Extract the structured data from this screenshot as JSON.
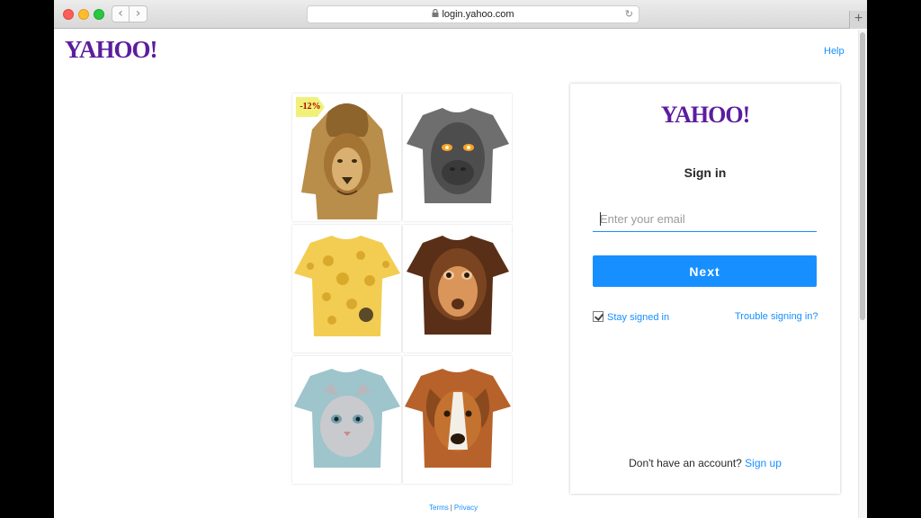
{
  "browser": {
    "url": "login.yahoo.com",
    "back_glyph": "‹",
    "forward_glyph": "›",
    "reload_glyph": "↻",
    "lock_glyph": "🔒",
    "new_tab_glyph": "+"
  },
  "header": {
    "logo": "YAHOO!",
    "help": "Help"
  },
  "ad": {
    "adchoices_glyph": "▷",
    "discount_badge": "-12%",
    "products": [
      {
        "name": "lion-hoodie",
        "color": "#b98d4a"
      },
      {
        "name": "gorilla-tshirt",
        "color": "#6e6e6e"
      },
      {
        "name": "cheese-tshirt",
        "color": "#f2cd52"
      },
      {
        "name": "orangutan-tshirt",
        "color": "#6b3a1f"
      },
      {
        "name": "kitten-tshirt",
        "color": "#9ec4cc"
      },
      {
        "name": "dog-tshirt",
        "color": "#b7622b"
      }
    ]
  },
  "login": {
    "logo": "YAHOO!",
    "title": "Sign in",
    "email_placeholder": "Enter your email",
    "next_label": "Next",
    "stay_signed_in": "Stay signed in",
    "trouble_link": "Trouble signing in?",
    "no_account_text": "Don't have an account?",
    "signup_link": "Sign up"
  },
  "footer": {
    "terms": "Terms",
    "separator": "|",
    "privacy": "Privacy"
  },
  "colors": {
    "brand_purple": "#5b1d9d",
    "link_blue": "#188fff"
  }
}
